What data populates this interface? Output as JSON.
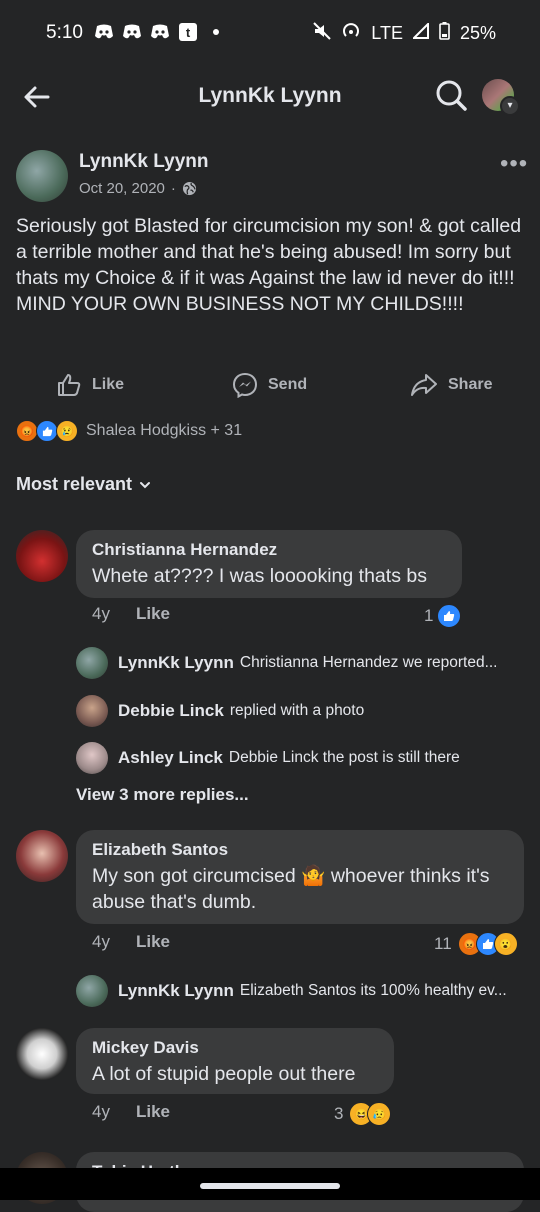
{
  "status": {
    "time": "5:10",
    "network": "LTE",
    "battery": "25%"
  },
  "header": {
    "title": "LynnKk Lyynn"
  },
  "post": {
    "author": "LynnKk Lyynn",
    "date": "Oct 20, 2020",
    "dot": "·",
    "text": "Seriously got Blasted for circumcision my son! & got called a terrible mother and that he's being abused! Im sorry but thats my Choice & if it was Against the law id never do it!!! MIND YOUR OWN BUSINESS NOT MY CHILDS!!!!",
    "actions": {
      "like": "Like",
      "send": "Send",
      "share": "Share"
    },
    "reactions_text": "Shalea Hodgkiss + 31"
  },
  "sort": {
    "label": "Most relevant"
  },
  "comments": [
    {
      "name": "Christianna Hernandez",
      "text": "Whete at???? I was looooking thats bs",
      "age": "4y",
      "like_label": "Like",
      "reaction_count": "1"
    },
    {
      "name": "Elizabeth Santos",
      "text": "My son got circumcised 🤷 whoever thinks it's abuse that's dumb.",
      "age": "4y",
      "like_label": "Like",
      "reaction_count": "11"
    },
    {
      "name": "Mickey Davis",
      "text": "A lot of stupid people out there",
      "age": "4y",
      "like_label": "Like",
      "reaction_count": "3"
    },
    {
      "name": "Tobie Hartless"
    }
  ],
  "replies": [
    {
      "name": "LynnKk Lyynn",
      "text": "Christianna Hernandez we reported..."
    },
    {
      "name": "Debbie Linck",
      "text": "replied with a photo"
    },
    {
      "name": "Ashley Linck",
      "text": "Debbie Linck the post is still there"
    },
    {
      "name": "LynnKk Lyynn",
      "text": "Elizabeth Santos its 100% healthy ev..."
    }
  ],
  "view_more_replies": "View 3 more replies...",
  "colors": {
    "background": "#242526",
    "bubble": "#3a3b3c",
    "like_blue": "#2d88ff"
  }
}
